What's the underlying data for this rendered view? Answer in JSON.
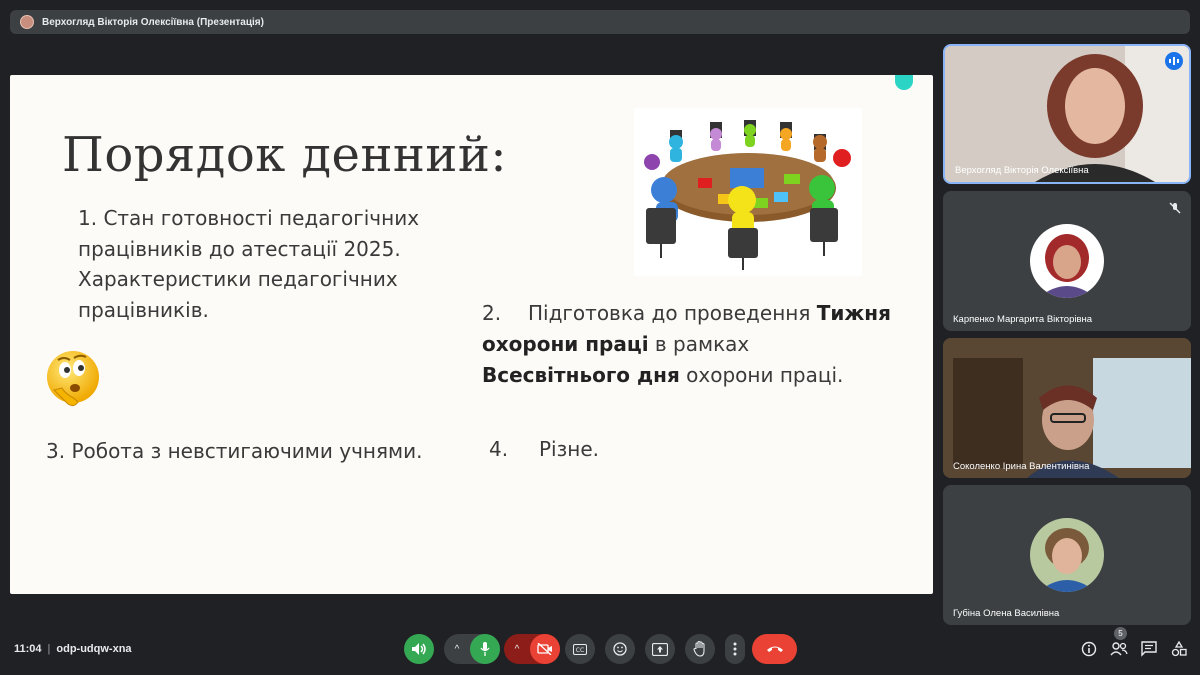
{
  "header": {
    "title": "Верхогляд Вікторія Олексіївна (Презентація)"
  },
  "slide": {
    "heading": "Порядок денний:",
    "item1": "1. Стан готовності педагогічних працівників до атестації 2025. Характеристики педагогічних працівників.",
    "item2": {
      "num": "2.",
      "part1": "Підготовка до проведення ",
      "bold1": "Тижня охорони праці",
      "part2": " в рамках ",
      "bold2": "Всесвітнього дня",
      "part3": " охорони праці."
    },
    "item3": "3.  Робота з невстигаючими учнями.",
    "item4": {
      "num": "4.",
      "text": "Різне."
    }
  },
  "participants": [
    {
      "name": "Верхогляд Вікторія Олексіївна",
      "status": "speaking"
    },
    {
      "name": "Карпенко Маргарита Вікторівна",
      "status": "muted"
    },
    {
      "name": "Соколенко Ірина Валентинівна",
      "status": "video"
    },
    {
      "name": "Губіна Олена Василівна",
      "status": "avatar"
    }
  ],
  "footer": {
    "time": "11:04",
    "separator": "|",
    "meeting_code": "odp-udqw-xna",
    "people_count": "5"
  },
  "colors": {
    "accent": "#8ab4f8",
    "mic_on": "#34a853",
    "cam_off": "#ea4335",
    "end_call": "#ea4335",
    "slide_dot": "#2bd4c4"
  },
  "icons": [
    "speaker-icon",
    "mic-icon",
    "camera-off-icon",
    "captions-icon",
    "emoji-icon",
    "present-icon",
    "raise-hand-icon",
    "more-icon",
    "end-call-icon",
    "info-icon",
    "people-icon",
    "chat-icon",
    "activities-icon"
  ]
}
